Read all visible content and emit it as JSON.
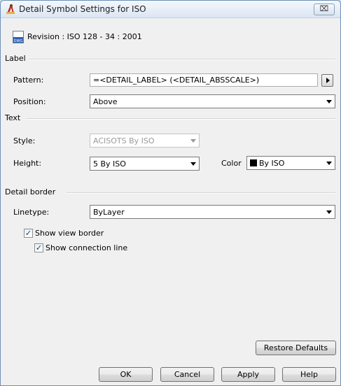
{
  "window": {
    "title": "Detail Symbol Settings for ISO",
    "close_glyph": "⌧"
  },
  "icons": {
    "app": "autocad-drafting-icon",
    "revision": "dwg-file-icon",
    "close": "close-icon"
  },
  "revision": {
    "text": "Revision : ISO 128 - 34 : 2001",
    "icon_text": "DWG"
  },
  "label_group": {
    "title": "Label",
    "pattern_label": "Pattern:",
    "pattern_value": "=<DETAIL_LABEL> (<DETAIL_ABSSCALE>)",
    "position_label": "Position:",
    "position_value": "Above"
  },
  "text_group": {
    "title": "Text",
    "style_label": "Style:",
    "style_value": "ACISOTS  By ISO",
    "height_label": "Height:",
    "height_value": "5  By ISO",
    "color_label": "Color",
    "color_value": "By ISO"
  },
  "border_group": {
    "title": "Detail border",
    "linetype_label": "Linetype:",
    "linetype_value": "ByLayer",
    "show_view_border": {
      "label": "Show view border",
      "checked": true
    },
    "show_connection_line": {
      "label": "Show connection line",
      "checked": true
    }
  },
  "buttons": {
    "restore": "Restore Defaults",
    "ok": "OK",
    "cancel": "Cancel",
    "apply": "Apply",
    "help": "Help"
  },
  "check_glyph": "✓",
  "colors": {
    "title_bar": "#dbe6f3",
    "dialog_bg": "#f0f0f0",
    "window_border": "#6d8fb3",
    "color_swatch": "#000000"
  }
}
